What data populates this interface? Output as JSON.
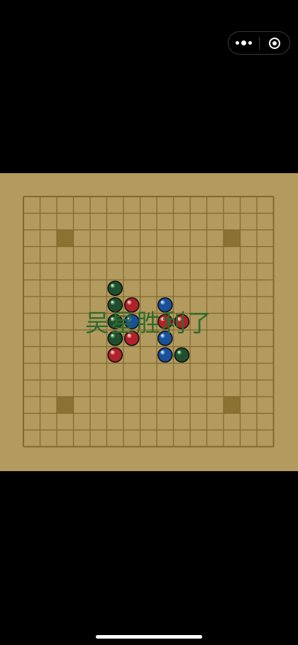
{
  "board": {
    "cells": 15,
    "bg_color": "#b39a5e",
    "line_color": "#806a2e",
    "star_color": "#8c7232",
    "star_points": [
      [
        2,
        2
      ],
      [
        12,
        2
      ],
      [
        2,
        12
      ],
      [
        12,
        12
      ]
    ]
  },
  "stones": [
    {
      "color": "green",
      "col": 5,
      "row": 5
    },
    {
      "color": "green",
      "col": 5,
      "row": 6
    },
    {
      "color": "red",
      "col": 6,
      "row": 6
    },
    {
      "color": "blue",
      "col": 8,
      "row": 6
    },
    {
      "color": "green",
      "col": 5,
      "row": 7
    },
    {
      "color": "blue",
      "col": 6,
      "row": 7
    },
    {
      "color": "red",
      "col": 8,
      "row": 7
    },
    {
      "color": "red",
      "col": 9,
      "row": 7
    },
    {
      "color": "green",
      "col": 5,
      "row": 8
    },
    {
      "color": "red",
      "col": 6,
      "row": 8
    },
    {
      "color": "blue",
      "col": 8,
      "row": 8
    },
    {
      "color": "red",
      "col": 5,
      "row": 9
    },
    {
      "color": "blue",
      "col": 8,
      "row": 9
    },
    {
      "color": "green",
      "col": 9,
      "row": 9
    }
  ],
  "stone_colors": {
    "green": {
      "base": "#1f4f2e",
      "hi": "#5f9e6e"
    },
    "red": {
      "base": "#b0222a",
      "hi": "#f07a7a"
    },
    "blue": {
      "base": "#1a4f9a",
      "hi": "#6fa3e8"
    }
  },
  "message": {
    "text": "吴星胜利了",
    "color": "#2f6b2f"
  }
}
